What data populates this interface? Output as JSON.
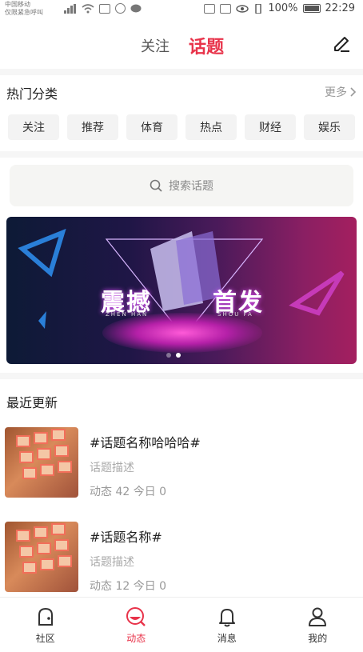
{
  "status_bar": {
    "carrier_line1": "中国移动",
    "carrier_line2": "仅限紧急呼叫",
    "battery": "100%",
    "time": "22:29"
  },
  "header": {
    "tab_follow": "关注",
    "tab_topic": "话题",
    "active_color": "#e8334a"
  },
  "categories": {
    "title": "热门分类",
    "more": "更多",
    "chips": [
      "关注",
      "推荐",
      "体育",
      "热点",
      "财经",
      "娱乐"
    ]
  },
  "search": {
    "placeholder": "搜索话题"
  },
  "banner": {
    "left_text": "震撼",
    "right_text": "首发",
    "left_sub": "ZHEN HAN",
    "right_sub": "SHOU FA",
    "slides": 2,
    "active_slide": 2
  },
  "recent": {
    "title": "最近更新",
    "items": [
      {
        "title": "#话题名称哈哈哈#",
        "desc": "话题描述",
        "stats": "动态 42 今日 0"
      },
      {
        "title": "#话题名称#",
        "desc": "话题描述",
        "stats": "动态 12 今日 0"
      }
    ]
  },
  "bottom_nav": {
    "items": [
      {
        "label": "社区",
        "icon": "community-icon"
      },
      {
        "label": "动态",
        "icon": "feed-icon"
      },
      {
        "label": "消息",
        "icon": "bell-icon"
      },
      {
        "label": "我的",
        "icon": "user-icon"
      }
    ],
    "active_index": 1
  }
}
